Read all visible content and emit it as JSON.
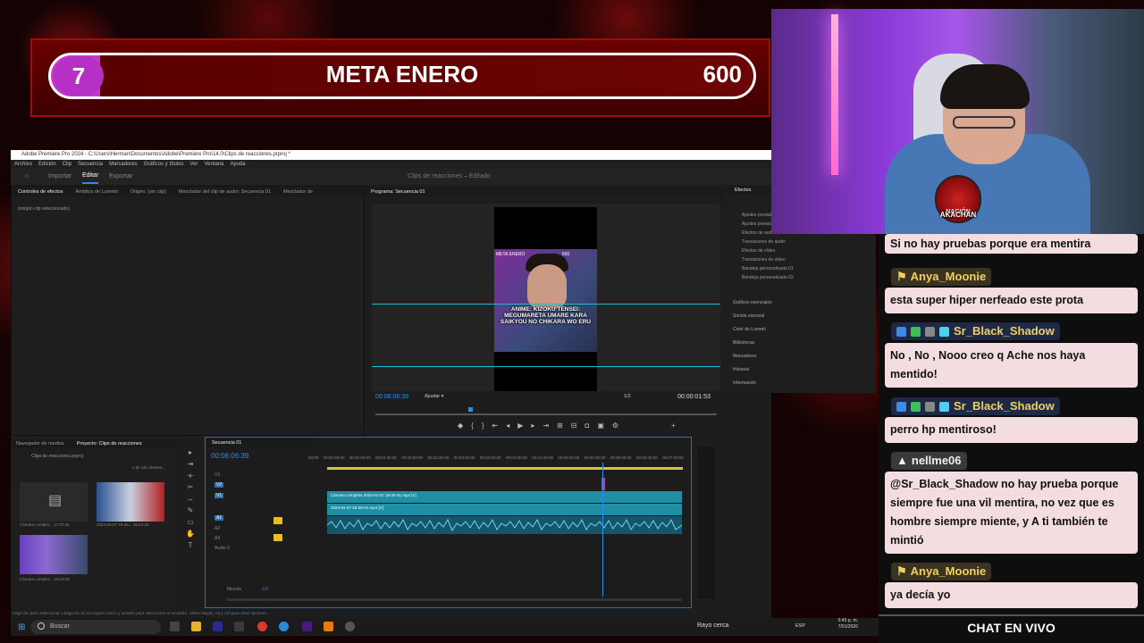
{
  "goal": {
    "count": "7",
    "title": "META ENERO",
    "target": "600"
  },
  "premiere": {
    "title_bar": "Adobe Premiere Pro 2024 - C:\\Users\\Herman\\Documentos\\Adobe\\Premiere Pro\\14.0\\Clips de reacciones.prproj *",
    "menus": [
      "Archivo",
      "Edición",
      "Clip",
      "Secuencia",
      "Marcadores",
      "Gráficos y títulos",
      "Ver",
      "Ventana",
      "Ayuda"
    ],
    "workspaces": [
      "Importar",
      "Editar",
      "Exportar"
    ],
    "project_title": "Clips de reacciones",
    "project_status": "Editado",
    "source_tabs": [
      "Controles de efectos",
      "Ámbitos de Lumetri",
      "Origen: (sin clip)",
      "Mezclador del clip de audio: Secuencia 01",
      "Mezclador de"
    ],
    "no_clip": "(ningún clip seleccionado)",
    "program_tab": "Programa: Secuencia 01",
    "program_timecode": "00:06:06:39",
    "fit": "Ajustar",
    "ratio": "1/2",
    "program_duration": "00:00:01:53",
    "frame_top": "META ENERO",
    "frame_top_num": "600",
    "frame_caption": "ANIME: KIZOKU TENSEI: MEGUMARETA UMARE KARA SAIKYOU NO CHIKARA WO ERU",
    "effects_tab": "Efectos",
    "effects_tree": [
      "Ajustes prestablecidos",
      "Ajustes preestablecidos de Lumetri",
      "Efectos de audio",
      "Transiciones de audio",
      "Efectos de vídeo",
      "Transiciones de vídeo",
      "Bandeja personalizada 01",
      "Bandeja personalizada 02"
    ],
    "effects_sections": [
      "Gráficos esenciales",
      "Sonido esencial",
      "Color de Lumetri",
      "Bibliotecas",
      "Marcadores",
      "Historial",
      "Información"
    ],
    "project_tabs": [
      "Navegador de medios",
      "Proyecto: Clips de reacciones"
    ],
    "project_file": "Clips de reacciones.prproj",
    "project_count": "1 de 181 elemen...",
    "project_items": [
      {
        "name": "Cámara complet...",
        "dur": "17:37:34"
      },
      {
        "name": "2024-01-07 18-25...",
        "dur": "19:24:18"
      },
      {
        "name": "Cámara complet...",
        "dur": "19:24:03"
      }
    ],
    "timeline_tab": "Secuencia 01",
    "timeline_timecode": "00:06:06:39",
    "ruler": [
      "00:00",
      "00:00:30:00",
      "00:01:00:00",
      "00:01:30:00",
      "00:02:00:00",
      "00:02:30:00",
      "00:03:00:00",
      "00:03:30:00",
      "00:04:00:00",
      "00:04:30:00",
      "00:05:00:00",
      "00:05:30:00",
      "00:06:00:00",
      "00:06:30:00",
      "00:07:00:00"
    ],
    "tracks": [
      "V3",
      "V2",
      "V1",
      "A1",
      "A2",
      "A3",
      "Audio 3"
    ],
    "master_label": "Mezcla",
    "master_value": "0,0",
    "clip_v2": "Cámara completa 2024-01-07 18-25-01.mp4 [V]",
    "clip_v1": "2024-01-07 18-25-01.mp4 [V]",
    "status_hint": "Haga clic para seleccionar o haga clic en un espacio vacío y arrastre para seleccionar el recuadro. Utilice Mayús, Alt y Ctrl para otras opciones."
  },
  "taskbar": {
    "search": "Buscar",
    "weather": "Rayo cerca",
    "lang": "ESP",
    "time": "6:45 p. m.",
    "date": "7/01/2026"
  },
  "webcam": {
    "logo_top": "NACIÓN",
    "logo_name": "AKACHAN"
  },
  "chat": {
    "partial": "Si no hay pruebas porque era mentira",
    "messages": [
      {
        "user": "Anya_Moonie",
        "text": "esta super hiper nerfeado este prota"
      },
      {
        "user": "Sr_Black_Shadow",
        "text": "No , No , Nooo creo q Ache nos haya mentido!"
      },
      {
        "user": "Sr_Black_Shadow",
        "text": "perro hp mentiroso!"
      },
      {
        "user": "nellme06",
        "text": "@Sr_Black_Shadow no hay prueba porque siempre fue una vil mentira, no vez que es hombre siempre miente, y A ti también te mintió"
      },
      {
        "user": "Anya_Moonie",
        "text": "ya decía yo"
      }
    ],
    "footer": "CHAT EN VIVO"
  },
  "colors": {
    "accent": "#2d8ceb",
    "clip": "#1f8fa5",
    "goal_purple": "#b730c6",
    "chat_bubble": "#f3dde0"
  }
}
